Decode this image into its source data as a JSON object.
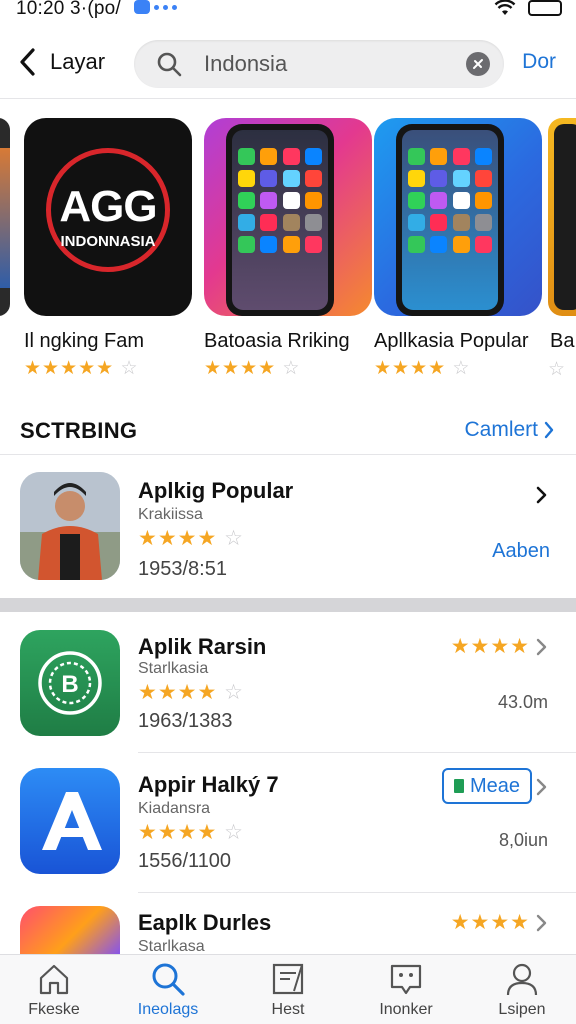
{
  "status_bar": {
    "time": "10:20 3·(po/"
  },
  "nav": {
    "back_label": "Layar",
    "search_value": "Indonsia",
    "done_label": "Dor"
  },
  "featured": [
    {
      "title": "Il ngking Fam",
      "stars_filled": "★★★★★",
      "stars_empty": "☆",
      "art": "AGG INDONESIA logo",
      "art_main": "AGG",
      "art_sub": "INDONNASIA"
    },
    {
      "title": "Batoasia Rriking",
      "stars_filled": "★★★★",
      "stars_empty": "☆",
      "art": "phone-pink"
    },
    {
      "title": "Apllkasia Popular",
      "stars_filled": "★★★★",
      "stars_empty": "☆",
      "art": "phone-blue"
    },
    {
      "title": "Ba",
      "stars_filled": "",
      "stars_empty": "☆",
      "art": "partial"
    }
  ],
  "section": {
    "title": "SCTRBING",
    "link": "Camlert"
  },
  "rows": [
    {
      "title": "Aplkig Popular",
      "subtitle": "Krakiissa",
      "stars_filled": "★★★★",
      "stars_empty": "☆",
      "meta": "1953/8:51",
      "action": "Aaben",
      "icon": "person-photo"
    },
    {
      "title": "Aplik Rarsin",
      "subtitle": "Starlkasia",
      "stars_filled": "★★★★",
      "stars_empty": "☆",
      "meta": "1963/1383",
      "right_stars": "★★★★",
      "size": "43.0m",
      "icon": "green-b-icon"
    },
    {
      "title": "Appir Halký 7",
      "subtitle": "Kiadansra",
      "stars_filled": "★★★★",
      "stars_empty": "☆",
      "meta": "1556/1100",
      "button": "Meae",
      "size": "8,0iun",
      "icon": "blue-a-icon"
    },
    {
      "title": "Eaplk Durles",
      "subtitle": "Starlkasa",
      "right_stars": "★★★★",
      "icon": "multicolor-icon"
    }
  ],
  "tabs": [
    {
      "label": "Fkeske",
      "icon": "home-icon",
      "active": false
    },
    {
      "label": "Ineolags",
      "icon": "search-icon",
      "active": true
    },
    {
      "label": "Hest",
      "icon": "notepad-icon",
      "active": false
    },
    {
      "label": "Inonker",
      "icon": "chat-icon",
      "active": false
    },
    {
      "label": "Lsipen",
      "icon": "person-icon",
      "active": false
    }
  ],
  "colors": {
    "accent": "#1e74d6",
    "star": "#f5a623"
  }
}
